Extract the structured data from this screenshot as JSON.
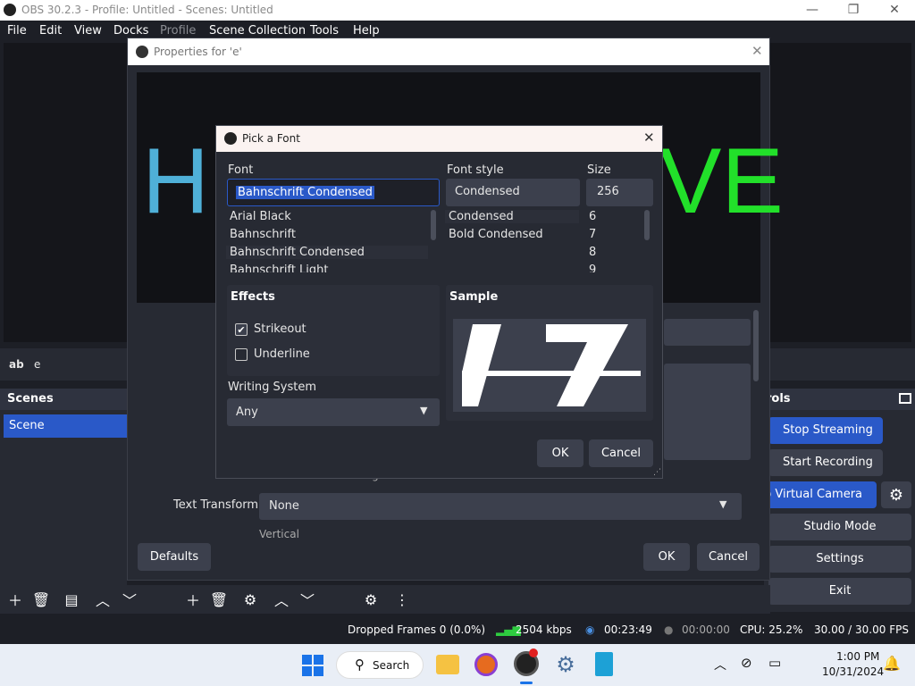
{
  "window": {
    "title": "OBS 30.2.3 - Profile: Untitled - Scenes: Untitled",
    "min": "—",
    "max": "❐",
    "close": "✕"
  },
  "menu": [
    "File",
    "Edit",
    "View",
    "Docks",
    "Profile",
    "Scene Collection",
    "Tools",
    "Help"
  ],
  "sources": {
    "type": "ab",
    "name": "e"
  },
  "scenes": {
    "header": "Scenes",
    "items": [
      "Scene"
    ]
  },
  "controls": {
    "header": "rols",
    "buttons": {
      "stop_streaming": "Stop Streaming",
      "start_recording": "Start Recording",
      "virtual_camera": "p Virtual Camera",
      "studio_mode": "Studio Mode",
      "settings": "Settings",
      "exit": "Exit"
    }
  },
  "statusbar": {
    "dropped": "Dropped Frames 0 (0.0%)",
    "bitrate": "2504 kbps",
    "stream_time": "00:23:49",
    "rec_time": "00:00:00",
    "cpu": "CPU: 25.2%",
    "fps": "30.00 / 30.00 FPS"
  },
  "props": {
    "title": "Properties for 'e'",
    "preview_left": "H",
    "preview_right": "VE",
    "text_transform_label": "Text Transform",
    "text_transform_value": "None",
    "defaults": "Defaults",
    "ok": "OK",
    "cancel": "Cancel",
    "partial_top": "Enable Antialiasing",
    "partial_bottom": "Vertical"
  },
  "font_dialog": {
    "title": "Pick a Font",
    "font_label": "Font",
    "font_value": "Bahnschrift Condensed",
    "fonts": [
      "Arial Black",
      "Bahnschrift",
      "Bahnschrift Condensed",
      "Bahnschrift Light"
    ],
    "style_label": "Font style",
    "style_value": "Condensed",
    "styles": [
      "Condensed",
      "Bold Condensed"
    ],
    "size_label": "Size",
    "size_value": "256",
    "sizes": [
      "6",
      "7",
      "8",
      "9"
    ],
    "effects_label": "Effects",
    "strikeout": "Strikeout",
    "strikeout_checked": true,
    "underline": "Underline",
    "underline_checked": false,
    "writing_label": "Writing System",
    "writing_value": "Any",
    "sample_label": "Sample",
    "ok": "OK",
    "cancel": "Cancel"
  },
  "taskbar": {
    "search": "Search",
    "time": "1:00 PM",
    "date": "10/31/2024"
  },
  "colors": {
    "accent": "#2a59c8",
    "preview_green": "#22e02a",
    "preview_blue": "#4fb0d8"
  }
}
